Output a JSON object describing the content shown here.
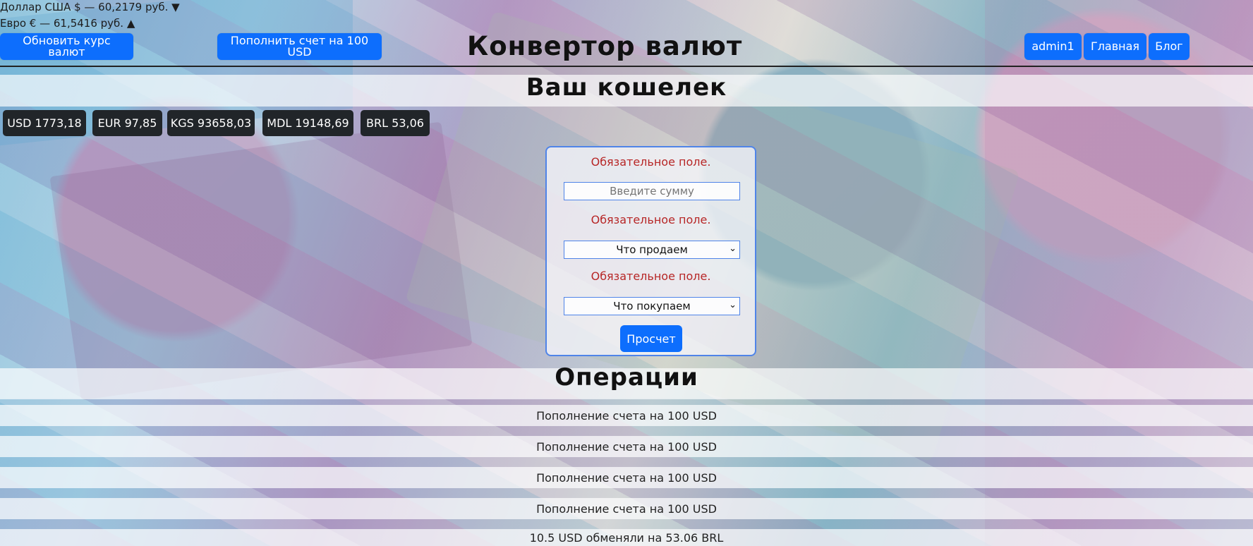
{
  "rates": {
    "usd": "Доллар США $ — 60,2179 руб. ▼",
    "eur": "Евро € — 61,5416 руб. ▲"
  },
  "header": {
    "update_rates_label": "Обновить курс валют",
    "topup_label": "Пополнить счет на 100 USD",
    "title": "Конвертор валют",
    "user_label": "admin1",
    "home_label": "Главная",
    "blog_label": "Блог"
  },
  "wallet": {
    "title": "Ваш кошелек",
    "balances": [
      "USD 1773,18",
      "EUR 97,85",
      "KGS 93658,03",
      "MDL 19148,69",
      "BRL 53,06"
    ]
  },
  "form": {
    "required_text": "Обязательное поле.",
    "amount_placeholder": "Введите сумму",
    "sell_label": "Что продаем",
    "buy_label": "Что покупаем",
    "submit_label": "Просчет"
  },
  "operations": {
    "title": "Операции",
    "items": [
      "Пополнение счета на 100 USD",
      "Пополнение счета на 100 USD",
      "Пополнение счета на 100 USD",
      "Пополнение счета на 100 USD",
      "10.5 USD обменяли на 53.06 BRL"
    ]
  }
}
